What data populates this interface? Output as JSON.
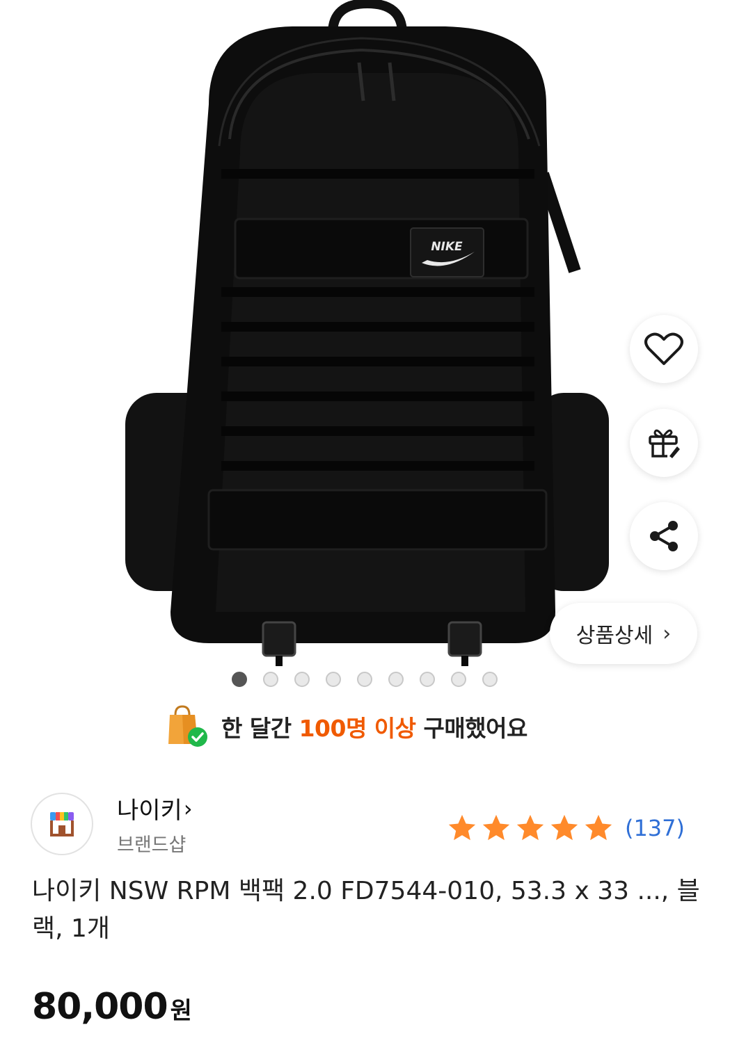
{
  "product_image": {
    "alt": "",
    "logo_text": "NIKE"
  },
  "actions": {
    "like_icon": "heart-icon",
    "gift_icon": "gift-icon",
    "share_icon": "share-icon",
    "detail_label": "상품상세",
    "detail_chevron": "›"
  },
  "carousel": {
    "total": 9,
    "active_index": 0
  },
  "social_proof": {
    "prefix": "한 달간 ",
    "highlight": "100명 이상",
    "suffix": " 구매했어요",
    "highlight_color": "#f05a00"
  },
  "brand": {
    "name": "나이키",
    "chevron": "›",
    "subtitle": "브랜드샵"
  },
  "rating": {
    "stars": 5,
    "max": 5,
    "count": "(137)",
    "star_color": "#ff8a2b"
  },
  "product": {
    "title": "나이키 NSW RPM 백팩 2.0 FD7544-010, 53.3 x 33 ..., 블랙, 1개",
    "price": "80,000",
    "currency": "원"
  }
}
